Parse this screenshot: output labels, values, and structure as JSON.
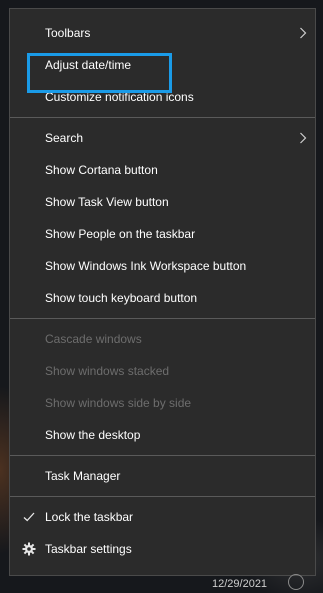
{
  "taskbar": {
    "clock_date": "12/29/2021"
  },
  "menu": {
    "groups": [
      [
        {
          "label": "Toolbars",
          "submenu": true
        },
        {
          "label": "Adjust date/time",
          "highlighted": true
        },
        {
          "label": "Customize notification icons"
        }
      ],
      [
        {
          "label": "Search",
          "submenu": true
        },
        {
          "label": "Show Cortana button"
        },
        {
          "label": "Show Task View button"
        },
        {
          "label": "Show People on the taskbar"
        },
        {
          "label": "Show Windows Ink Workspace button"
        },
        {
          "label": "Show touch keyboard button"
        }
      ],
      [
        {
          "label": "Cascade windows",
          "disabled": true
        },
        {
          "label": "Show windows stacked",
          "disabled": true
        },
        {
          "label": "Show windows side by side",
          "disabled": true
        },
        {
          "label": "Show the desktop"
        }
      ],
      [
        {
          "label": "Task Manager"
        }
      ],
      [
        {
          "label": "Lock the taskbar",
          "icon": "checkmark-icon",
          "checked": true
        },
        {
          "label": "Taskbar settings",
          "icon": "gear-icon"
        }
      ]
    ]
  },
  "colors": {
    "menu_background": "#2b2b2b",
    "text": "#ffffff",
    "disabled_text": "#6d6d6d",
    "highlight_border": "#1a9be8"
  }
}
